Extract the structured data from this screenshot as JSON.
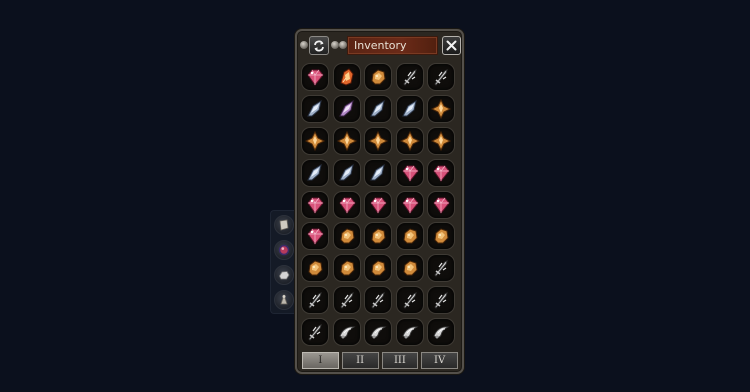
{
  "window": {
    "title": "Inventory"
  },
  "side_buttons": [
    {
      "icon": "scroll-icon"
    },
    {
      "icon": "gem-orb-icon"
    },
    {
      "icon": "stone-icon"
    },
    {
      "icon": "figure-icon"
    }
  ],
  "grid": {
    "rows": [
      [
        "ruby-gem",
        "fire-crystal",
        "amber-ore",
        "silver-dagger",
        "silver-dagger"
      ],
      [
        "steel-shard",
        "amethyst-shard",
        "steel-shard",
        "steel-shard",
        "amber-crystal"
      ],
      [
        "amber-crystal",
        "amber-crystal",
        "amber-crystal",
        "amber-crystal",
        "amber-crystal"
      ],
      [
        "steel-shard",
        "steel-shard",
        "steel-shard",
        "ruby-gem",
        "ruby-gem"
      ],
      [
        "ruby-gem",
        "ruby-gem",
        "ruby-gem",
        "ruby-gem",
        "ruby-gem"
      ],
      [
        "ruby-gem",
        "amber-ore",
        "amber-ore",
        "amber-ore",
        "amber-ore"
      ],
      [
        "amber-ore",
        "amber-ore",
        "amber-ore",
        "amber-ore",
        "silver-dagger"
      ],
      [
        "silver-dagger",
        "silver-dagger",
        "silver-dagger",
        "silver-dagger",
        "silver-dagger"
      ],
      [
        "silver-dagger",
        "silver-claw",
        "silver-claw",
        "silver-claw",
        "silver-claw"
      ]
    ]
  },
  "tabs": [
    {
      "label": "I",
      "active": true
    },
    {
      "label": "II",
      "active": false
    },
    {
      "label": "III",
      "active": false
    },
    {
      "label": "IV",
      "active": false
    }
  ],
  "colors": {
    "background": "#0b101d",
    "title_plate": "#6b2a18",
    "ruby": "#d8527a",
    "amber": "#d08a3a",
    "steel": "#9fb0c8",
    "silver": "#d6d6d6",
    "fire": "#e2662a",
    "amethyst": "#b48ac8"
  }
}
